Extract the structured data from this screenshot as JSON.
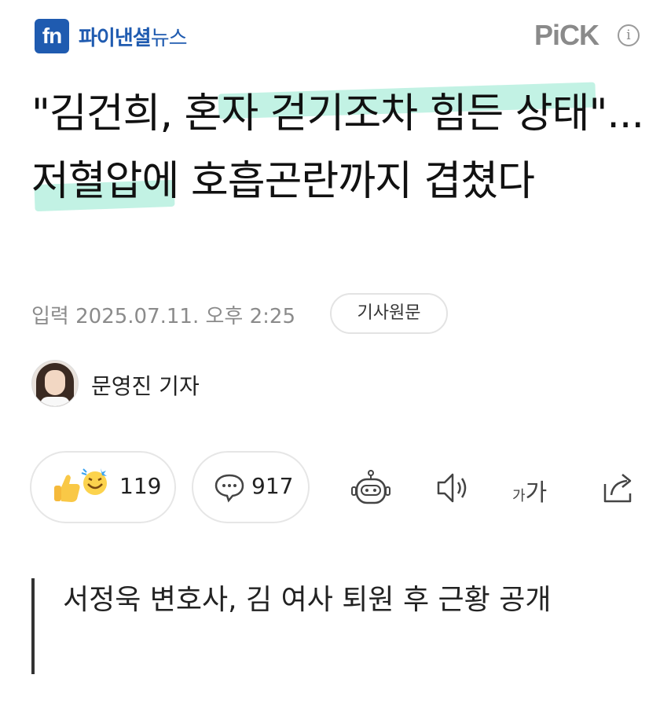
{
  "header": {
    "logo_mark": "fn",
    "logo_name": "파이낸셜",
    "logo_news": "뉴스",
    "pick_label": "PiCK",
    "info_symbol": "i"
  },
  "article": {
    "headline": "\"김건희, 혼자 걷기조차 힘든 상태\"...저혈압에 호흡곤란까지 겹쳤다",
    "date": "입력 2025.07.11. 오후 2:25",
    "original_link_label": "기사원문",
    "reporter": "문영진 기자",
    "subheading": "서정욱 변호사, 김 여사 퇴원 후 근황 공개"
  },
  "actions": {
    "reaction_count": "119",
    "comment_count": "917",
    "font_size_small": "가",
    "font_size_large": "가"
  },
  "icons": [
    "thumbs-up-icon",
    "smile-icon",
    "comment-bubble-icon",
    "robot-icon",
    "speaker-icon",
    "font-size-icon",
    "share-icon",
    "info-icon"
  ],
  "colors": {
    "brand": "#1f5bb0",
    "highlight": "#a8ecd8",
    "muted_text": "#8b8b8b"
  }
}
